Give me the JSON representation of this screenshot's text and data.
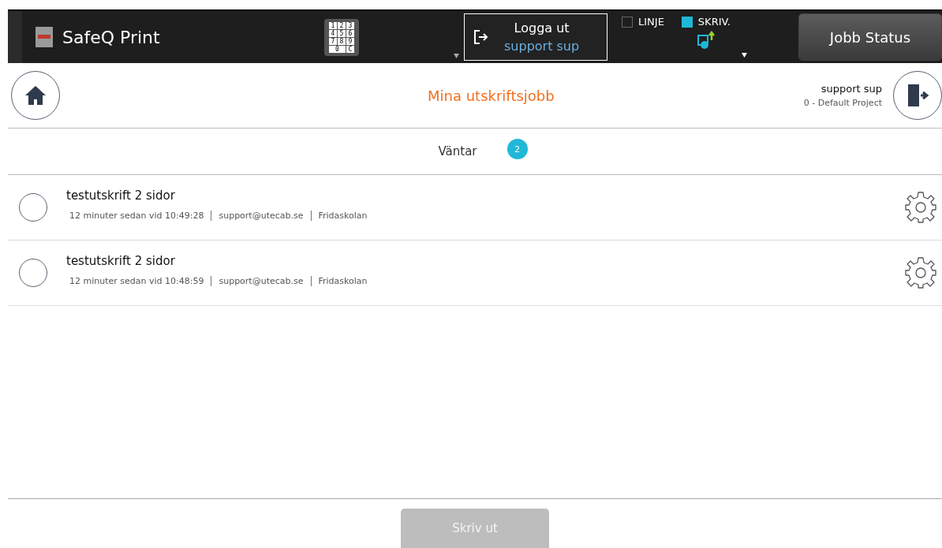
{
  "topbar": {
    "app_title": "SafeQ Print",
    "keypad": [
      "1",
      "2",
      "3",
      "4",
      "5",
      "6",
      "7",
      "8",
      "9",
      "0",
      "C"
    ],
    "logout": {
      "label": "Logga ut",
      "user": "support sup"
    },
    "modes": [
      {
        "label": "LINJE",
        "checked": false
      },
      {
        "label": "SKRIV.",
        "checked": true
      }
    ],
    "job_status": "Jobb Status"
  },
  "header": {
    "title": "Mina utskriftsjobb",
    "user": "support sup",
    "project": "0 - Default Project"
  },
  "tab": {
    "label": "Väntar",
    "count": "2"
  },
  "jobs": [
    {
      "name": "testutskrift 2 sidor",
      "time": "12 minuter sedan vid 10:49:28",
      "email": "support@utecab.se",
      "location": "Fridaskolan",
      "selected": false
    },
    {
      "name": "testutskrift 2 sidor",
      "time": "12 minuter sedan vid 10:48:59",
      "email": "support@utecab.se",
      "location": "Fridaskolan",
      "selected": false
    }
  ],
  "print_button": {
    "label": "Skriv ut",
    "disabled": true
  }
}
